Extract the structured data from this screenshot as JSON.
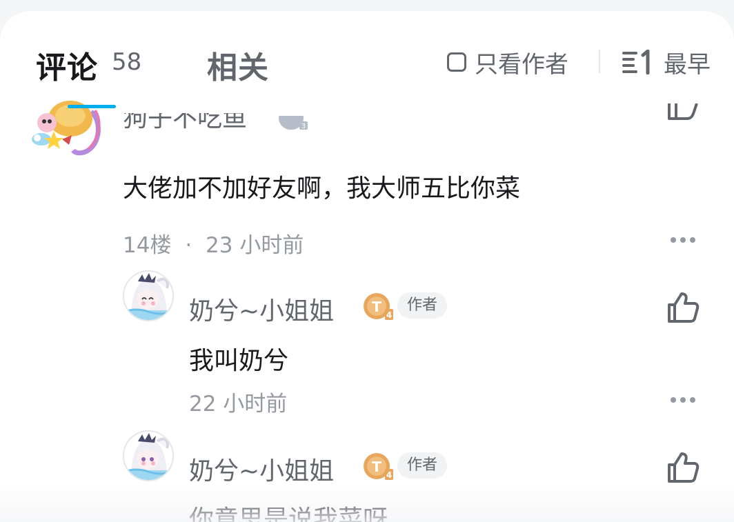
{
  "header": {
    "tab_comments": "评论",
    "comment_count": "58",
    "tab_related": "相关",
    "author_only_label": "只看作者",
    "sort_label": "最早"
  },
  "top_comment": {
    "username": "狗子不吃鱼",
    "level": "3",
    "text": "大佬加不加好友啊，我大师五比你菜",
    "floor": "14楼",
    "separator": "·",
    "time": "23 小时前"
  },
  "replies": [
    {
      "username": "奶兮~小姐姐",
      "level": "4",
      "tag": "作者",
      "text": "我叫奶兮",
      "time": "22 小时前"
    },
    {
      "username": "奶兮~小姐姐",
      "level": "4",
      "tag": "作者",
      "text": "你意思是说我菜呀"
    }
  ],
  "colors": {
    "accent": "#00aeec",
    "text_primary": "#18191c",
    "text_secondary": "#61666d",
    "text_muted": "#9499a0",
    "level_badge_gold": "#e8a65c",
    "level_badge_silver": "#b6bcc8"
  },
  "icons": {
    "checkbox": "checkbox-icon",
    "sort": "sort-earliest-icon",
    "like": "thumbs-up-icon",
    "more": "more-dots-icon"
  }
}
